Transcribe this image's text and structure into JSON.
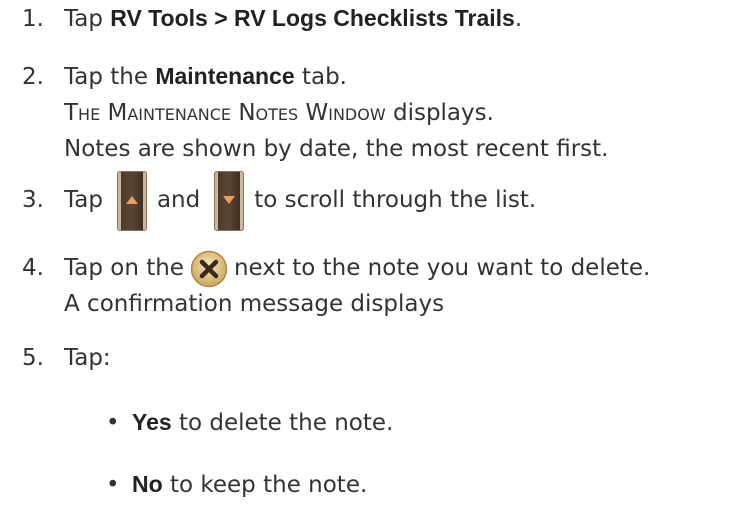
{
  "steps": [
    {
      "number": "1.",
      "prefix": "Tap ",
      "bold": "RV Tools > RV Logs Checklists Trails",
      "suffix": "."
    },
    {
      "number": "2.",
      "prefix": "Tap the ",
      "bold": "Maintenance",
      "suffix": " tab.",
      "line2_smallcaps": "The Maintenance Notes Window",
      "line2_rest": " displays.",
      "line3": "Notes are shown by date, the most recent first."
    },
    {
      "number": "3.",
      "prefix": "Tap",
      "middle": "and",
      "suffix": "to scroll through the list.",
      "icons": [
        "scroll-up-button-icon",
        "scroll-down-button-icon"
      ]
    },
    {
      "number": "4.",
      "prefix": "Tap on the",
      "suffix": "next to the note you want to delete.",
      "line2": "A confirmation message displays",
      "icons": [
        "delete-x-button-icon"
      ]
    },
    {
      "number": "5.",
      "text": "Tap:"
    }
  ],
  "bullets": [
    {
      "bold": "Yes",
      "rest": " to delete the note."
    },
    {
      "bold": "No",
      "rest": " to keep the note."
    }
  ],
  "colors": {
    "text": "#333333",
    "button_brown": "#4a3a2c",
    "button_frame": "#c9b99a",
    "arrow": "#e8a060",
    "delete_ring": "#e0c890",
    "delete_x": "#3a2a1a"
  }
}
